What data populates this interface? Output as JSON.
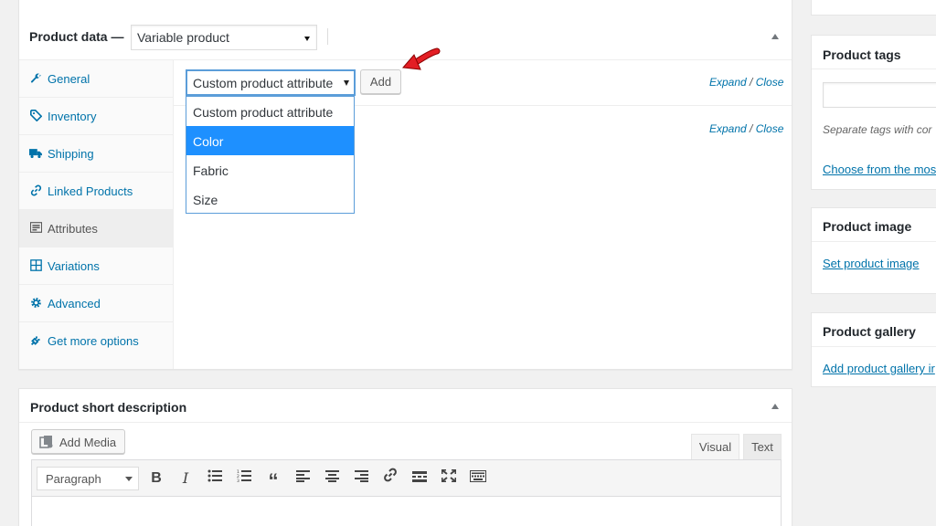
{
  "product_data": {
    "title": "Product data —",
    "type_select": "Variable product",
    "tabs": [
      {
        "label": "General",
        "icon": "wrench-icon"
      },
      {
        "label": "Inventory",
        "icon": "tag-icon"
      },
      {
        "label": "Shipping",
        "icon": "truck-icon"
      },
      {
        "label": "Linked Products",
        "icon": "link-icon"
      },
      {
        "label": "Attributes",
        "icon": "list-icon"
      },
      {
        "label": "Variations",
        "icon": "grid-icon"
      },
      {
        "label": "Advanced",
        "icon": "gear-icon"
      },
      {
        "label": "Get more options",
        "icon": "plugin-icon"
      }
    ],
    "active_tab": "Attributes",
    "attribute_select": "Custom product attribute",
    "add_label": "Add",
    "expand_label": "Expand",
    "close_label": "Close",
    "separator": "/",
    "dropdown_options": [
      "Custom product attribute",
      "Color",
      "Fabric",
      "Size"
    ],
    "dropdown_highlighted": "Color"
  },
  "short_description": {
    "title": "Product short description",
    "add_media_label": "Add Media",
    "tab_visual": "Visual",
    "tab_text": "Text",
    "paragraph_select": "Paragraph",
    "toolbar_buttons": [
      "bold-icon",
      "italic-icon",
      "bullet-list-icon",
      "numbered-list-icon",
      "blockquote-icon",
      "align-left-icon",
      "align-center-icon",
      "align-right-icon",
      "link-icon",
      "read-more-icon",
      "fullscreen-icon",
      "toolbar-toggle-icon"
    ]
  },
  "sidebar": {
    "tags": {
      "title": "Product tags",
      "help": "Separate tags with cor",
      "choose_link": "Choose from the mos"
    },
    "image": {
      "title": "Product image",
      "link": "Set product image"
    },
    "gallery": {
      "title": "Product gallery",
      "link": "Add product gallery ir"
    }
  },
  "colors": {
    "link": "#0073aa",
    "highlight": "#1e90ff",
    "arrow": "#e31e24"
  }
}
